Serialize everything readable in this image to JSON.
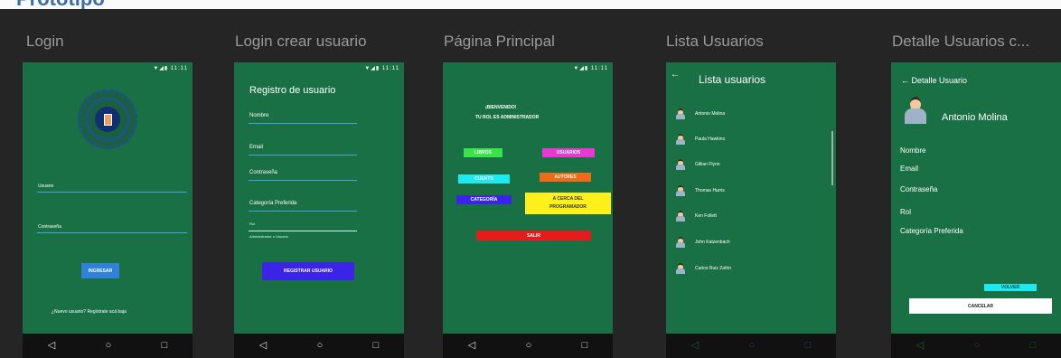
{
  "page": {
    "title": "Prototipo"
  },
  "frames": [
    {
      "title": "Login"
    },
    {
      "title": "Login crear usuario"
    },
    {
      "title": "Página Principal"
    },
    {
      "title": "Lista Usuarios"
    },
    {
      "title": "Detalle Usuarios c..."
    }
  ],
  "status_icons": "▼◢▮ 11:11",
  "nav": {
    "back": "◁",
    "home": "○",
    "recents": "□"
  },
  "login": {
    "usuario_label": "Usuario",
    "contrasena_label": "Contraseña",
    "ingresar": "INGRESAR",
    "register_link": "¿Nuevo usuario? Regístrate acá baja"
  },
  "registro": {
    "title": "Registro de usuario",
    "nombre": "Nombre",
    "email": "Email",
    "contrasena": "Contraseña",
    "categoria": "Categoría Preferida",
    "rol": "Rol",
    "rol_hint": "Administrador o Usuario",
    "registrar": "REGISTRAR USUARIO"
  },
  "principal": {
    "welcome": "¡BIENVENIDO!",
    "role": "TU ROL ES ADMINISTRADOR",
    "libros": "LIBROS",
    "usuarios": "USUARIOS",
    "cuentas": "CUENTS",
    "autores": "AUTORES",
    "categoria": "CATEGORÍA",
    "acerca1": "A CERCA DEL",
    "acerca2": "PROGRAMADOR",
    "salir": "SALIR"
  },
  "lista": {
    "back": "←",
    "title": "Lista usuarios",
    "users": [
      "Antonio Molina",
      "Paula Hawkins",
      "Gillian Flynn",
      "Thomas Harris",
      "Ken Follett",
      "John Katzenbach",
      "Carlos Ruiz Zafón"
    ]
  },
  "detalle": {
    "header": "← Detalle Usuario",
    "name": "Antonio Molina",
    "nombre": "Nombre",
    "email": "Email",
    "contrasena": "Contraseña",
    "rol": "Rol",
    "categoria": "Categoría Preferida",
    "volver": "VOLVER",
    "cancelar": "CANCELAR"
  },
  "colors": {
    "phone_bg": "#1a7045",
    "canvas_bg": "#252525",
    "cyan": "#1de9f0",
    "green": "#3be34a",
    "magenta": "#e83ad0",
    "orange": "#f06a18",
    "blue": "#3b24e8",
    "yellow": "#ffef1a",
    "red": "#e41c1c",
    "login_btn": "#2f82d8"
  }
}
